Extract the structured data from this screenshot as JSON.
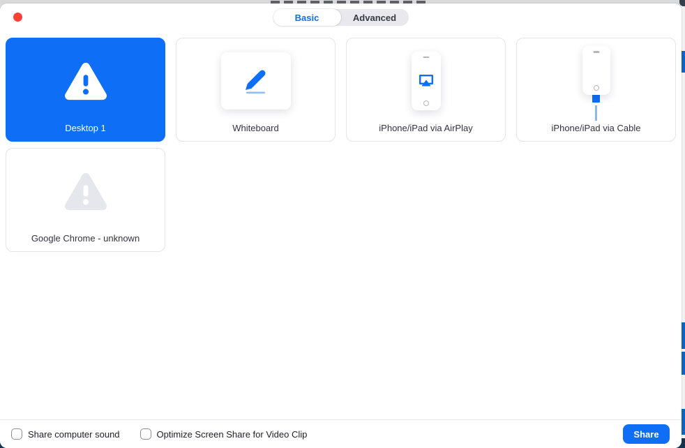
{
  "dialog": {
    "tabs": {
      "items": [
        {
          "label": "Basic",
          "selected": true
        },
        {
          "label": "Advanced",
          "selected": false
        }
      ]
    },
    "tiles": [
      {
        "label": "Desktop 1",
        "icon": "warning-triangle-icon",
        "selected": true
      },
      {
        "label": "Whiteboard",
        "icon": "pen-icon",
        "selected": false
      },
      {
        "label": "iPhone/iPad via AirPlay",
        "icon": "airplay-phone-icon",
        "selected": false
      },
      {
        "label": "iPhone/iPad via Cable",
        "icon": "cable-phone-icon",
        "selected": false
      },
      {
        "label": "Google Chrome - unknown",
        "icon": "warning-triangle-icon",
        "selected": false
      }
    ],
    "footer": {
      "checkboxes": [
        {
          "label": "Share computer sound",
          "checked": false
        },
        {
          "label": "Optimize Screen Share for Video Clip",
          "checked": false
        }
      ],
      "share_button_label": "Share"
    },
    "colors": {
      "accent_blue": "#0e6ef6",
      "icon_gray": "#e6e6ed",
      "close_button_red": "#fc4238",
      "bleed_blue": "#0e63c0",
      "bleed_dark": "#17344f"
    }
  }
}
